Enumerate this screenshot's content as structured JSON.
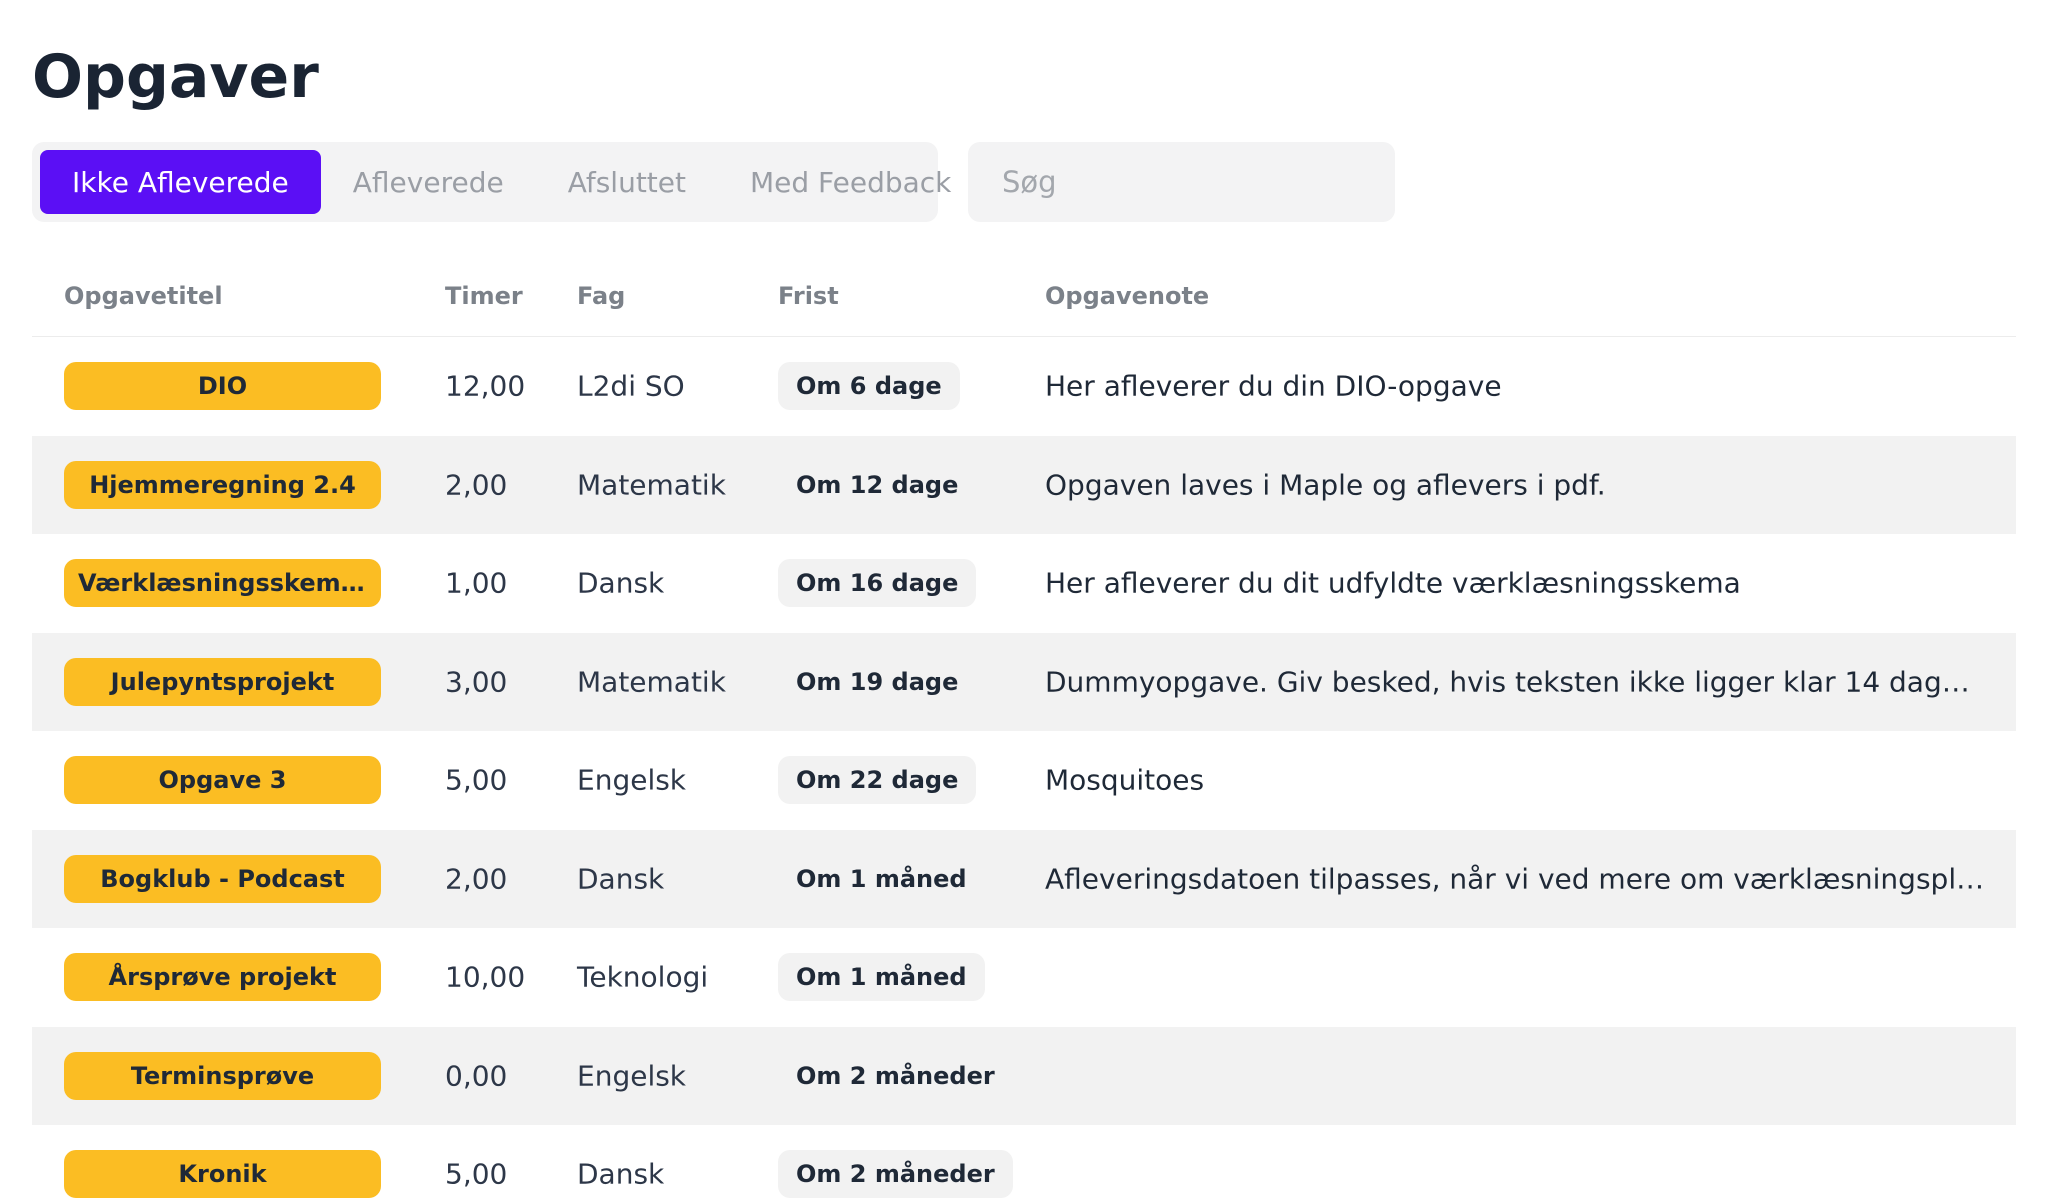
{
  "page": {
    "title": "Opgaver"
  },
  "tabs": [
    {
      "label": "Ikke Afleverede",
      "active": true
    },
    {
      "label": "Afleverede",
      "active": false
    },
    {
      "label": "Afsluttet",
      "active": false
    },
    {
      "label": "Med Feedback",
      "active": false
    }
  ],
  "search": {
    "placeholder": "Søg",
    "value": ""
  },
  "table": {
    "headers": {
      "title": "Opgavetitel",
      "hours": "Timer",
      "subject": "Fag",
      "deadline": "Frist",
      "note": "Opgavenote"
    },
    "rows": [
      {
        "title": "DIO",
        "hours": "12,00",
        "subject": "L2di SO",
        "deadline": "Om 6 dage",
        "note": "Her afleverer du din DIO-opgave"
      },
      {
        "title": "Hjemmeregning 2.4",
        "hours": "2,00",
        "subject": "Matematik",
        "deadline": "Om 12 dage",
        "note": "Opgaven laves i Maple og aflevers i pdf."
      },
      {
        "title": "Værklæsningsskema \"...",
        "hours": "1,00",
        "subject": "Dansk",
        "deadline": "Om 16 dage",
        "note": "Her afleverer du dit udfyldte værklæsningsskema"
      },
      {
        "title": "Julepyntsprojekt",
        "hours": "3,00",
        "subject": "Matematik",
        "deadline": "Om 19 dage",
        "note": "Dummyopgave. Giv besked, hvis teksten ikke ligger klar 14 dage før..."
      },
      {
        "title": "Opgave 3",
        "hours": "5,00",
        "subject": "Engelsk",
        "deadline": "Om 22 dage",
        "note": "Mosquitoes"
      },
      {
        "title": "Bogklub - Podcast",
        "hours": "2,00",
        "subject": "Dansk",
        "deadline": "Om 1 måned",
        "note": "Afleveringsdatoen tilpasses, når vi ved mere om værklæsningsplanen...."
      },
      {
        "title": "Årsprøve projekt",
        "hours": "10,00",
        "subject": "Teknologi",
        "deadline": "Om 1 måned",
        "note": ""
      },
      {
        "title": "Terminsprøve",
        "hours": "0,00",
        "subject": "Engelsk",
        "deadline": "Om 2 måneder",
        "note": ""
      },
      {
        "title": "Kronik",
        "hours": "5,00",
        "subject": "Dansk",
        "deadline": "Om 2 måneder",
        "note": ""
      }
    ]
  },
  "colors": {
    "accent": "#5b0ff5",
    "pill": "#fbbd23",
    "row_alt": "#f2f2f2"
  }
}
